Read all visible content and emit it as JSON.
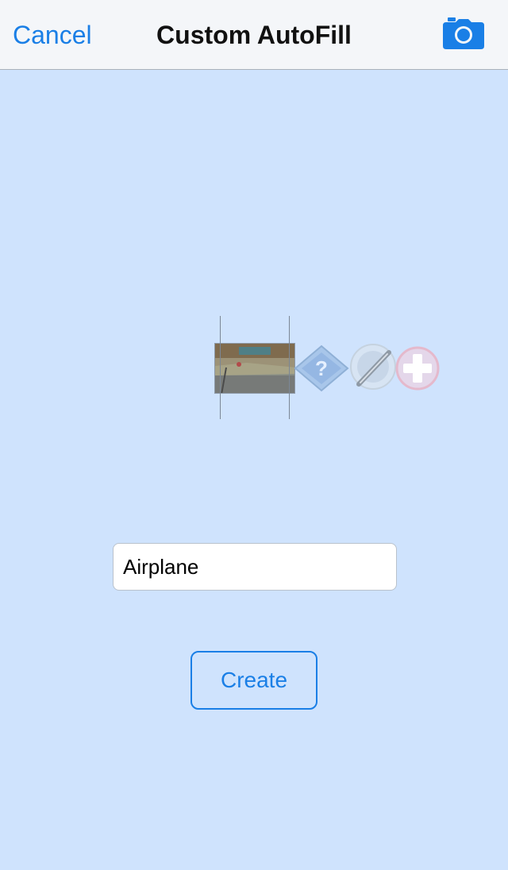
{
  "navbar": {
    "cancel_label": "Cancel",
    "title": "Custom AutoFill",
    "camera_icon": "camera-icon"
  },
  "image_strip": {
    "items": [
      {
        "icon": "photo-thumbnail"
      },
      {
        "icon": "question-diamond-icon"
      },
      {
        "icon": "magnifier-lens-icon"
      },
      {
        "icon": "plus-circle-icon"
      }
    ]
  },
  "form": {
    "name_value": "Airplane",
    "create_label": "Create"
  },
  "colors": {
    "accent": "#1a7fe6",
    "background": "#cfe3fd",
    "navbar_bg": "#f4f6f9"
  }
}
